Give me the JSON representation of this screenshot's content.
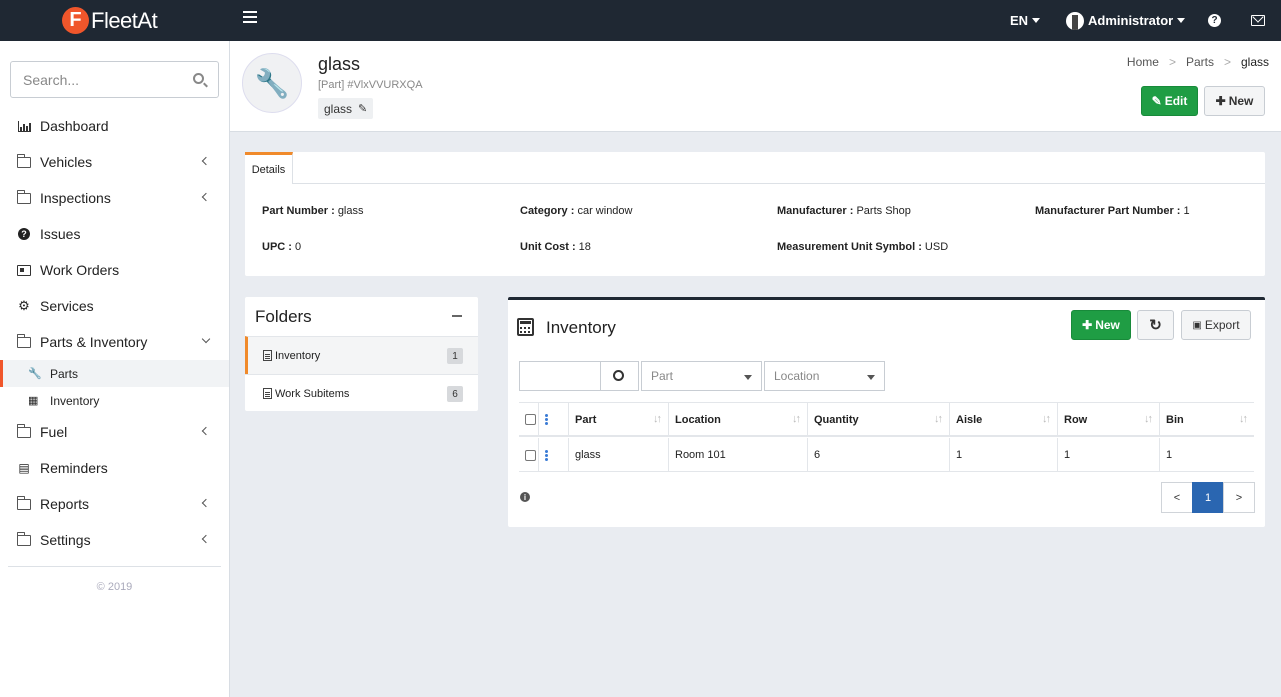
{
  "topbar": {
    "logo_letter": "F",
    "logo_text": "FleetAt",
    "language": "EN",
    "user": "Administrator"
  },
  "sidebar": {
    "search_placeholder": "Search...",
    "items": [
      {
        "label": "Dashboard"
      },
      {
        "label": "Vehicles"
      },
      {
        "label": "Inspections"
      },
      {
        "label": "Issues"
      },
      {
        "label": "Work Orders"
      },
      {
        "label": "Services"
      },
      {
        "label": "Parts & Inventory"
      },
      {
        "label": "Parts"
      },
      {
        "label": "Inventory"
      },
      {
        "label": "Fuel"
      },
      {
        "label": "Reminders"
      },
      {
        "label": "Reports"
      },
      {
        "label": "Settings"
      }
    ],
    "copyright": "© 2019"
  },
  "header": {
    "title": "glass",
    "subtitle": "[Part] #VlxVVURXQA",
    "tag": "glass",
    "breadcrumb": [
      "Home",
      "Parts",
      "glass"
    ],
    "breadcrumb_sep": ">",
    "edit_label": "Edit",
    "new_label": "New"
  },
  "details": {
    "tab": "Details",
    "fields": [
      {
        "label": "Part Number :",
        "value": "glass"
      },
      {
        "label": "Category :",
        "value": "car window"
      },
      {
        "label": "Manufacturer :",
        "value": "Parts Shop"
      },
      {
        "label": "Manufacturer Part Number :",
        "value": "1"
      },
      {
        "label": "UPC :",
        "value": "0"
      },
      {
        "label": "Unit Cost :",
        "value": "18"
      },
      {
        "label": "Measurement Unit Symbol :",
        "value": "USD"
      }
    ]
  },
  "folders": {
    "title": "Folders",
    "items": [
      {
        "label": "Inventory",
        "count": "1"
      },
      {
        "label": "Work Subitems",
        "count": "6"
      }
    ]
  },
  "inventory": {
    "title": "Inventory",
    "new_label": "New",
    "export_label": "Export",
    "part_filter": "Part",
    "location_filter": "Location",
    "columns": [
      "Part",
      "Location",
      "Quantity",
      "Aisle",
      "Row",
      "Bin"
    ],
    "rows": [
      [
        "glass",
        "Room 101",
        "6",
        "1",
        "1",
        "1"
      ]
    ],
    "pager": {
      "prev": "<",
      "page": "1",
      "next": ">"
    }
  }
}
